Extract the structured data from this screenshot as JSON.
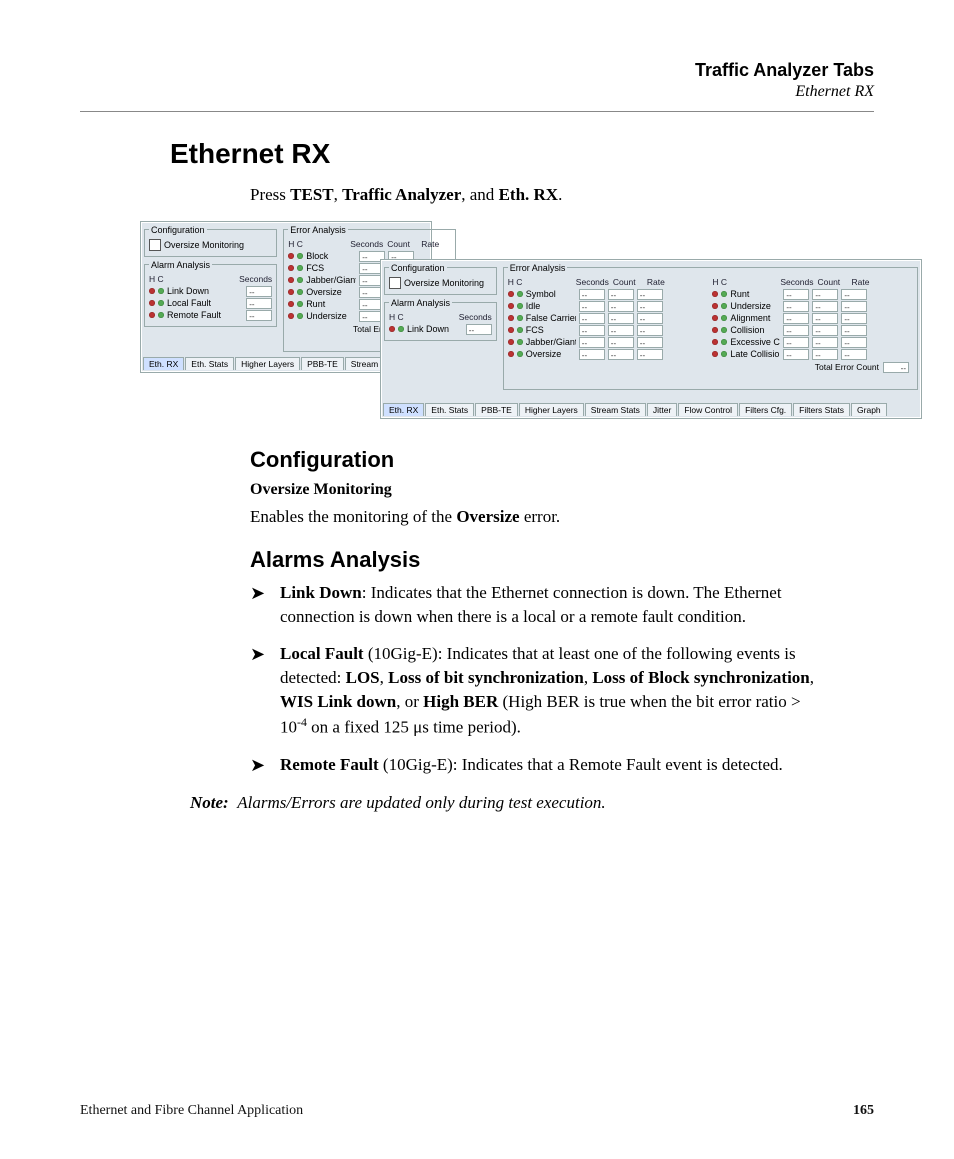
{
  "header": {
    "chapter": "Traffic Analyzer Tabs",
    "topic": "Ethernet RX"
  },
  "title": "Ethernet RX",
  "intro": {
    "prefix": "Press ",
    "b1": "TEST",
    "sep1": ", ",
    "b2": "Traffic Analyzer",
    "sep2": ", and ",
    "b3": "Eth. RX",
    "suffix": "."
  },
  "screenshot": {
    "groups": {
      "configuration": "Configuration",
      "oversize_monitoring": "Oversize Monitoring",
      "alarm_analysis": "Alarm Analysis",
      "error_analysis": "Error Analysis"
    },
    "cols": {
      "hc": "H   C",
      "seconds": "Seconds",
      "count": "Count",
      "rate": "Rate"
    },
    "placeholder": "--",
    "total_label": "Total Error Count",
    "small_panel": {
      "alarms": [
        "Link Down",
        "Local Fault",
        "Remote Fault"
      ],
      "errors": [
        "Block",
        "FCS",
        "Jabber/Giant",
        "Oversize",
        "Runt",
        "Undersize"
      ],
      "tabs": [
        "Eth. RX",
        "Eth. Stats",
        "Higher Layers",
        "PBB-TE",
        "Stream Stat"
      ]
    },
    "large_panel": {
      "alarms": [
        "Link Down"
      ],
      "errors_left": [
        "Symbol",
        "Idle",
        "False Carrier",
        "FCS",
        "Jabber/Giant",
        "Oversize"
      ],
      "errors_right": [
        "Runt",
        "Undersize",
        "Alignment",
        "Collision",
        "Excessive Col.",
        "Late Collision"
      ],
      "tabs": [
        "Eth. RX",
        "Eth. Stats",
        "PBB-TE",
        "Higher Layers",
        "Stream Stats",
        "Jitter",
        "Flow Control",
        "Filters Cfg.",
        "Filters Stats",
        "Graph"
      ]
    }
  },
  "configuration": {
    "heading": "Configuration",
    "sub": "Oversize Monitoring",
    "text_pre": "Enables the monitoring of the ",
    "text_b": "Oversize",
    "text_post": " error."
  },
  "alarms": {
    "heading": "Alarms Analysis",
    "items": [
      {
        "lead_b": "Link Down",
        "rest": ": Indicates that the Ethernet connection is down. The Ethernet connection is down when there is a local or a remote fault condition."
      },
      {
        "lead_b": "Local Fault",
        "mid1": " (10Gig-E): Indicates that at least one of the following events is detected: ",
        "b1": "LOS",
        "s1": ", ",
        "b2": "Loss of bit synchronization",
        "s2": ", ",
        "b3": "Loss of Block synchronization",
        "s3": ", ",
        "b4": "WIS Link down",
        "s4": ", or ",
        "b5": "High BER",
        "tail_pre": " (High BER is true when the bit error ratio > 10",
        "tail_sup": "-4",
        "tail_post": " on a fixed 125 μs time period)."
      },
      {
        "lead_b": "Remote Fault",
        "rest": " (10Gig-E): Indicates that a Remote Fault event is detected."
      }
    ]
  },
  "note": {
    "label": "Note:",
    "text": "Alarms/Errors are updated only during test execution."
  },
  "footer": {
    "left": "Ethernet and Fibre Channel Application",
    "right": "165"
  }
}
